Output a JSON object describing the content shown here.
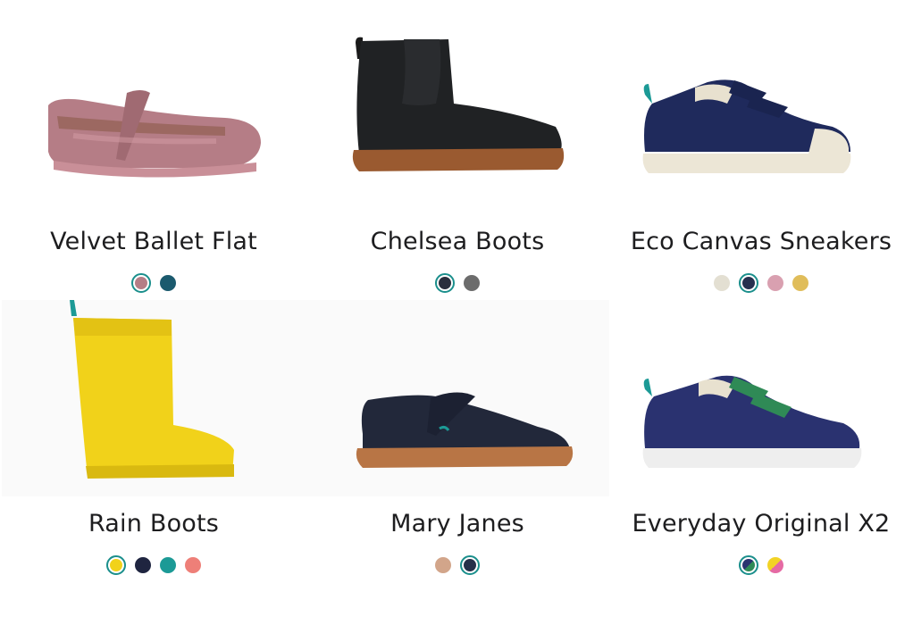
{
  "products": [
    {
      "name": "Velvet Ballet Flat",
      "swatches": [
        {
          "color": "#b57d86",
          "selected": true
        },
        {
          "color": "#1b5a6e",
          "selected": false
        }
      ]
    },
    {
      "name": "Chelsea Boots",
      "swatches": [
        {
          "color": "#2a2f3d",
          "selected": true
        },
        {
          "color": "#6c6c6c",
          "selected": false
        }
      ]
    },
    {
      "name": "Eco Canvas Sneakers",
      "swatches": [
        {
          "color": "#e3dfd2",
          "selected": false
        },
        {
          "color": "#27304f",
          "selected": true
        },
        {
          "color": "#d9a0b0",
          "selected": false
        },
        {
          "color": "#e0bd5a",
          "selected": false
        }
      ]
    },
    {
      "name": "Rain Boots",
      "swatches": [
        {
          "color": "#f1d21a",
          "selected": true
        },
        {
          "color": "#1f2540",
          "selected": false
        },
        {
          "color": "#1c9a96",
          "selected": false
        },
        {
          "color": "#ee7f78",
          "selected": false
        }
      ]
    },
    {
      "name": "Mary Janes",
      "swatches": [
        {
          "color": "#d2a58a",
          "selected": false
        },
        {
          "color": "#26304a",
          "selected": true
        }
      ]
    },
    {
      "name": "Everyday Original X2",
      "swatches": [
        {
          "color": "#2a3270",
          "color2": "#2f8a56",
          "selected": true
        },
        {
          "color": "#f2d326",
          "color2": "#e56aa4",
          "selected": false
        }
      ]
    }
  ],
  "icons": {
    "product_images": [
      "velvet-ballet-flat-image",
      "chelsea-boots-image",
      "eco-canvas-sneakers-image",
      "rain-boots-image",
      "mary-janes-image",
      "everyday-original-x2-image"
    ]
  }
}
